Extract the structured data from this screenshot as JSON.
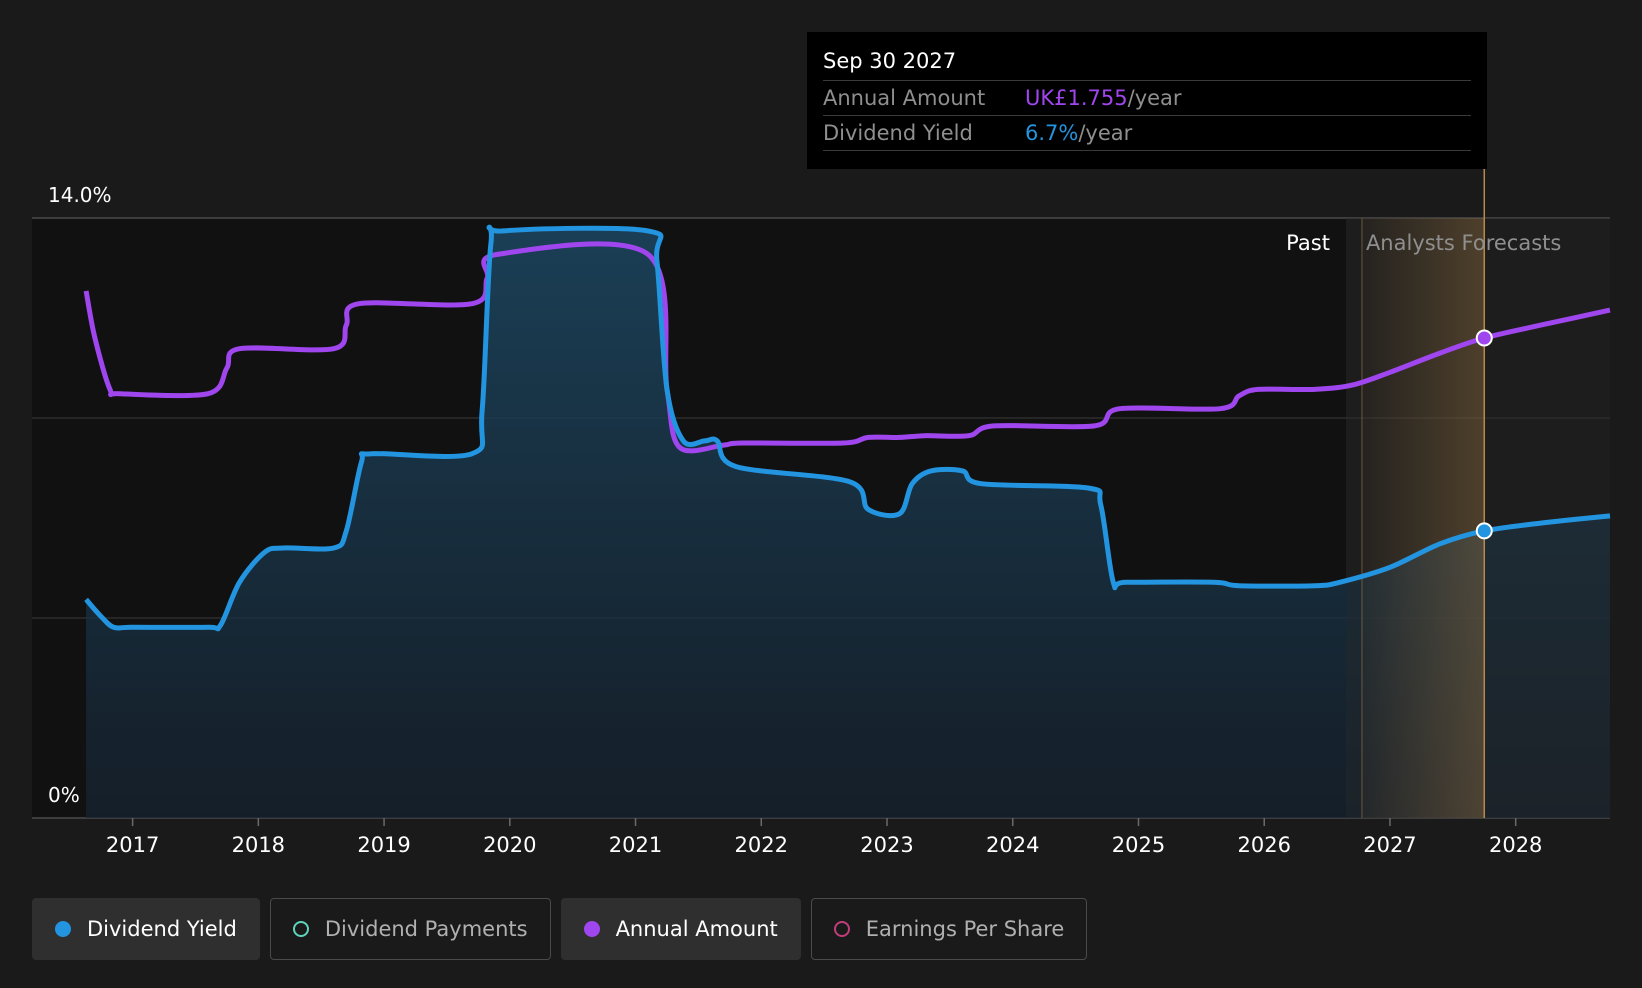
{
  "tooltip": {
    "date": "Sep 30 2027",
    "annual_label": "Annual Amount",
    "annual_value": "UK£1.755",
    "annual_unit": "/year",
    "yield_label": "Dividend Yield",
    "yield_value": "6.7%",
    "yield_unit": "/year"
  },
  "legend": [
    {
      "label": "Dividend Yield",
      "color": "#2394df",
      "active": true
    },
    {
      "label": "Dividend Payments",
      "color": "#5fd3bc",
      "active": false
    },
    {
      "label": "Annual Amount",
      "color": "#a046ef",
      "active": true
    },
    {
      "label": "Earnings Per Share",
      "color": "#c03d7a",
      "active": false
    }
  ],
  "chart_data": {
    "type": "line",
    "ylim": [
      0,
      14.0
    ],
    "xlim": [
      2016.2,
      2028.75
    ],
    "y_tick_labels": [
      "14.0%",
      "0%"
    ],
    "x_tick_labels": [
      "2017",
      "2018",
      "2019",
      "2020",
      "2021",
      "2022",
      "2023",
      "2024",
      "2025",
      "2026",
      "2027",
      "2028"
    ],
    "past_label": "Past",
    "forecast_label": "Analysts Forecasts",
    "forecast_start": 2026.65,
    "highlight_x": 2027.75,
    "colors": {
      "yield": "#2394df",
      "annual": "#a046ef",
      "highlight": "#b7894a"
    },
    "series": [
      {
        "name": "Dividend Yield",
        "points": [
          [
            2016.63,
            5.1
          ],
          [
            2016.75,
            4.7
          ],
          [
            2016.85,
            4.45
          ],
          [
            2017.0,
            4.45
          ],
          [
            2017.6,
            4.45
          ],
          [
            2017.7,
            4.5
          ],
          [
            2017.85,
            5.5
          ],
          [
            2018.05,
            6.2
          ],
          [
            2018.2,
            6.3
          ],
          [
            2018.6,
            6.3
          ],
          [
            2018.7,
            6.7
          ],
          [
            2018.82,
            8.3
          ],
          [
            2018.9,
            8.5
          ],
          [
            2019.7,
            8.5
          ],
          [
            2019.78,
            9.5
          ],
          [
            2019.85,
            13.4
          ],
          [
            2019.95,
            13.7
          ],
          [
            2021.1,
            13.7
          ],
          [
            2021.17,
            13.0
          ],
          [
            2021.25,
            10.0
          ],
          [
            2021.38,
            8.8
          ],
          [
            2021.55,
            8.8
          ],
          [
            2021.65,
            8.8
          ],
          [
            2021.8,
            8.2
          ],
          [
            2022.7,
            7.85
          ],
          [
            2022.85,
            7.2
          ],
          [
            2023.1,
            7.1
          ],
          [
            2023.2,
            7.8
          ],
          [
            2023.35,
            8.1
          ],
          [
            2023.6,
            8.1
          ],
          [
            2023.75,
            7.8
          ],
          [
            2024.6,
            7.7
          ],
          [
            2024.7,
            7.3
          ],
          [
            2024.8,
            5.5
          ],
          [
            2024.9,
            5.5
          ],
          [
            2025.6,
            5.5
          ],
          [
            2025.8,
            5.42
          ],
          [
            2026.4,
            5.42
          ],
          [
            2026.6,
            5.5
          ],
          [
            2027.0,
            5.85
          ],
          [
            2027.4,
            6.4
          ],
          [
            2027.75,
            6.7
          ],
          [
            2028.2,
            6.88
          ],
          [
            2028.75,
            7.05
          ]
        ]
      },
      {
        "name": "Annual Amount",
        "points": [
          [
            2016.63,
            12.3
          ],
          [
            2016.7,
            11.2
          ],
          [
            2016.82,
            10.0
          ],
          [
            2016.9,
            9.9
          ],
          [
            2017.6,
            9.9
          ],
          [
            2017.75,
            10.5
          ],
          [
            2017.85,
            10.95
          ],
          [
            2018.6,
            10.95
          ],
          [
            2018.7,
            11.5
          ],
          [
            2018.8,
            12.0
          ],
          [
            2019.7,
            12.0
          ],
          [
            2019.82,
            12.6
          ],
          [
            2019.9,
            13.15
          ],
          [
            2021.1,
            13.15
          ],
          [
            2021.25,
            10.0
          ],
          [
            2021.35,
            8.65
          ],
          [
            2021.7,
            8.7
          ],
          [
            2021.85,
            8.75
          ],
          [
            2022.65,
            8.75
          ],
          [
            2022.85,
            8.88
          ],
          [
            2023.1,
            8.88
          ],
          [
            2023.3,
            8.92
          ],
          [
            2023.65,
            8.92
          ],
          [
            2023.85,
            9.15
          ],
          [
            2024.65,
            9.15
          ],
          [
            2024.85,
            9.55
          ],
          [
            2025.65,
            9.55
          ],
          [
            2025.8,
            9.85
          ],
          [
            2025.95,
            10.0
          ],
          [
            2026.4,
            10.0
          ],
          [
            2026.7,
            10.1
          ],
          [
            2027.0,
            10.4
          ],
          [
            2027.4,
            10.85
          ],
          [
            2027.75,
            11.2
          ],
          [
            2028.2,
            11.5
          ],
          [
            2028.75,
            11.85
          ]
        ]
      }
    ]
  }
}
